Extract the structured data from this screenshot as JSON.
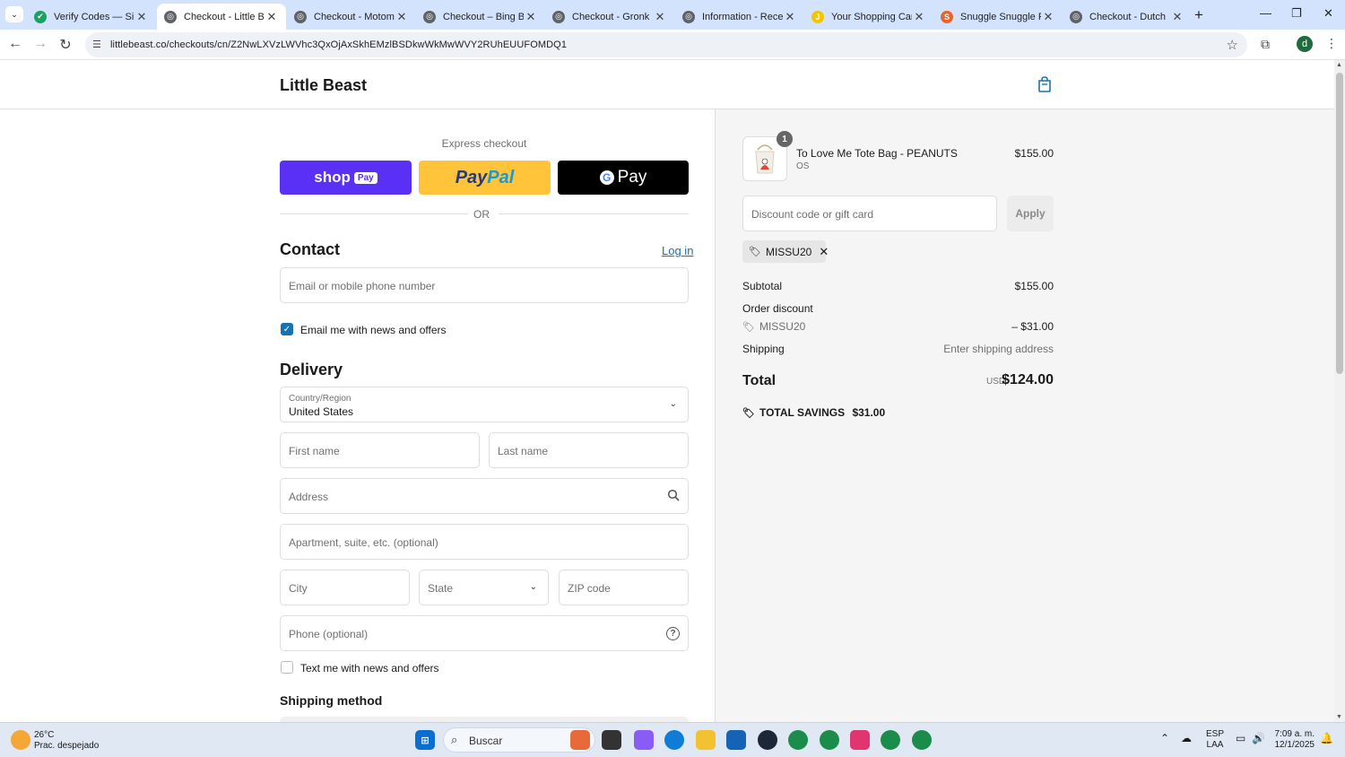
{
  "browser": {
    "tabs": [
      {
        "title": "Verify Codes — Simp",
        "fav_color": "#1aa260",
        "fav_glyph": "✔"
      },
      {
        "title": "Checkout - Little Bea",
        "fav_color": "#5f6368",
        "fav_glyph": "◎"
      },
      {
        "title": "Checkout - Motomo",
        "fav_color": "#5f6368",
        "fav_glyph": "◎"
      },
      {
        "title": "Checkout – Bing Beve",
        "fav_color": "#5f6368",
        "fav_glyph": "◎"
      },
      {
        "title": "Checkout - Gronk Fit",
        "fav_color": "#5f6368",
        "fav_glyph": "◎"
      },
      {
        "title": "Information - Recess",
        "fav_color": "#5f6368",
        "fav_glyph": "◎"
      },
      {
        "title": "Your Shopping Cart |",
        "fav_color": "#f5c400",
        "fav_glyph": "J"
      },
      {
        "title": "Snuggle Snuggle Fab",
        "fav_color": "#e8642c",
        "fav_glyph": "S"
      },
      {
        "title": "Checkout - Dutch",
        "fav_color": "#5f6368",
        "fav_glyph": "◎"
      }
    ],
    "url": "littlebeast.co/checkouts/cn/Z2NwLXVzLWVhc3QxOjAxSkhEMzlBSDkwWkMwWVY2RUhEUUFOMDQ1",
    "profile_initial": "d"
  },
  "store": {
    "name": "Little Beast"
  },
  "checkout": {
    "express_label": "Express checkout",
    "shop_pay_label": "shop",
    "shop_pay_pill": "Pay",
    "paypal_a": "Pay",
    "paypal_b": "Pal",
    "gpay_label": "Pay",
    "or_label": "OR",
    "contact_heading": "Contact",
    "login_link": "Log in",
    "email_placeholder": "Email or mobile phone number",
    "email_news_label": "Email me with news and offers",
    "email_news_checked": true,
    "delivery_heading": "Delivery",
    "country_label": "Country/Region",
    "country_value": "United States",
    "first_name_placeholder": "First name",
    "last_name_placeholder": "Last name",
    "address_placeholder": "Address",
    "apartment_placeholder": "Apartment, suite, etc. (optional)",
    "city_placeholder": "City",
    "state_placeholder": "State",
    "zip_placeholder": "ZIP code",
    "phone_placeholder": "Phone (optional)",
    "text_news_label": "Text me with news and offers",
    "text_news_checked": false,
    "shipping_method_heading": "Shipping method"
  },
  "summary": {
    "item": {
      "name": "To Love Me Tote Bag - PEANUTS",
      "variant": "OS",
      "price": "$155.00",
      "quantity": "1"
    },
    "discount_placeholder": "Discount code or gift card",
    "apply_label": "Apply",
    "applied_code": "MISSU20",
    "subtotal_label": "Subtotal",
    "subtotal_value": "$155.00",
    "order_discount_label": "Order discount",
    "discount_code": "MISSU20",
    "discount_value": "– $31.00",
    "shipping_label": "Shipping",
    "shipping_value": "Enter shipping address",
    "total_label": "Total",
    "currency": "USD",
    "total_value": "$124.00",
    "savings_label": "TOTAL SAVINGS",
    "savings_value": "$31.00"
  },
  "taskbar": {
    "weather_temp": "26°C",
    "weather_desc": "Prac. despejado",
    "search_label": "Buscar",
    "lang_top": "ESP",
    "lang_bottom": "LAA",
    "time": "7:09 a. m.",
    "date": "12/1/2025"
  }
}
